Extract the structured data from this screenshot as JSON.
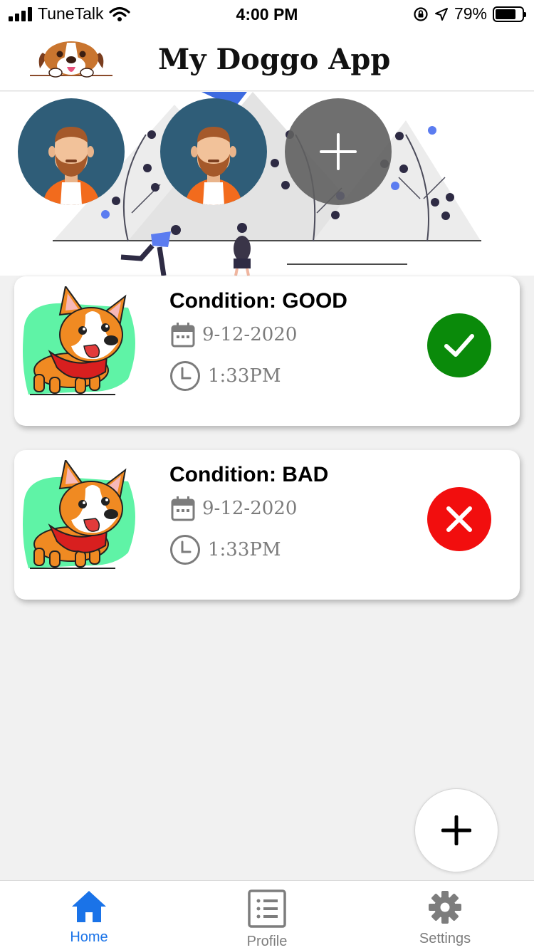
{
  "status_bar": {
    "carrier": "TuneTalk",
    "time": "4:00 PM",
    "battery": "79%",
    "battery_level": 0.79
  },
  "header": {
    "title": "My Doggo App",
    "logo_icon": "beagle-logo-icon"
  },
  "hero": {
    "avatars": [
      {
        "icon": "bearded-man-avatar-icon"
      },
      {
        "icon": "bearded-man-avatar-icon"
      }
    ],
    "add_icon": "plus-icon"
  },
  "records": [
    {
      "condition": "Condition: GOOD",
      "date": "9-12-2020",
      "time": "1:33PM",
      "status": "good",
      "status_icon": "check-icon",
      "status_color": "#0a8a0a"
    },
    {
      "condition": "Condition: BAD",
      "date": "9-12-2020",
      "time": "1:33PM",
      "status": "bad",
      "status_icon": "close-icon",
      "status_color": "#f20e0e"
    }
  ],
  "fab": {
    "icon": "plus-icon"
  },
  "tabs": [
    {
      "label": "Home",
      "icon": "home-icon",
      "active": true
    },
    {
      "label": "Profile",
      "icon": "list-icon",
      "active": false
    },
    {
      "label": "Settings",
      "icon": "gear-icon",
      "active": false
    }
  ],
  "colors": {
    "accent": "#1a73e8",
    "inactive": "#7d7d7d",
    "good": "#0a8a0a",
    "bad": "#f20e0e",
    "dog_bg": "#5ff3a6"
  }
}
